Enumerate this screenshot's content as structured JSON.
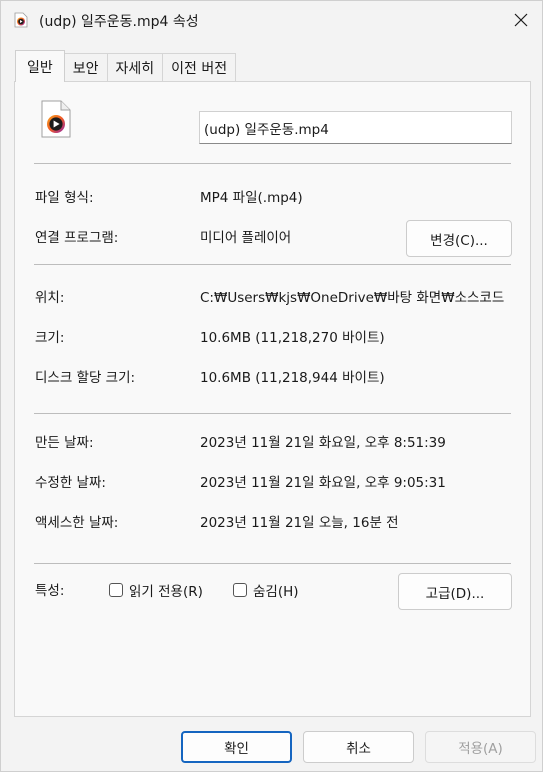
{
  "window": {
    "title": "(udp) 일주운동.mp4 속성"
  },
  "tabs": [
    {
      "label": "일반",
      "active": true
    },
    {
      "label": "보안",
      "active": false
    },
    {
      "label": "자세히",
      "active": false
    },
    {
      "label": "이전 버전",
      "active": false
    }
  ],
  "general": {
    "filename": "(udp) 일주운동.mp4",
    "file_type_label": "파일 형식:",
    "file_type_value": "MP4 파일(.mp4)",
    "opens_with_label": "연결 프로그램:",
    "opens_with_value": "미디어 플레이어",
    "change_button": "변경(C)...",
    "location_label": "위치:",
    "location_value": "C:₩Users₩kjs₩OneDrive₩바탕 화면₩소스코드",
    "size_label": "크기:",
    "size_value": "10.6MB (11,218,270 바이트)",
    "size_on_disk_label": "디스크 할당 크기:",
    "size_on_disk_value": "10.6MB (11,218,944 바이트)",
    "created_label": "만든 날짜:",
    "created_value": "2023년 11월 21일 화요일, 오후 8:51:39",
    "modified_label": "수정한 날짜:",
    "modified_value": "2023년 11월 21일 화요일, 오후 9:05:31",
    "accessed_label": "액세스한 날짜:",
    "accessed_value": "2023년 11월 21일 오늘, 16분 전",
    "attributes_label": "특성:",
    "readonly_label": "읽기 전용(R)",
    "readonly_checked": false,
    "hidden_label": "숨김(H)",
    "hidden_checked": false,
    "advanced_button": "고급(D)..."
  },
  "footer": {
    "ok": "확인",
    "cancel": "취소",
    "apply": "적용(A)"
  },
  "icons": {
    "title_icon": "media-file-icon",
    "file_icon": "media-file-icon",
    "close": "close-icon"
  },
  "colors": {
    "accent": "#1565c0",
    "media_icon_orange": "#f05a28",
    "media_icon_purple": "#8e24aa"
  }
}
